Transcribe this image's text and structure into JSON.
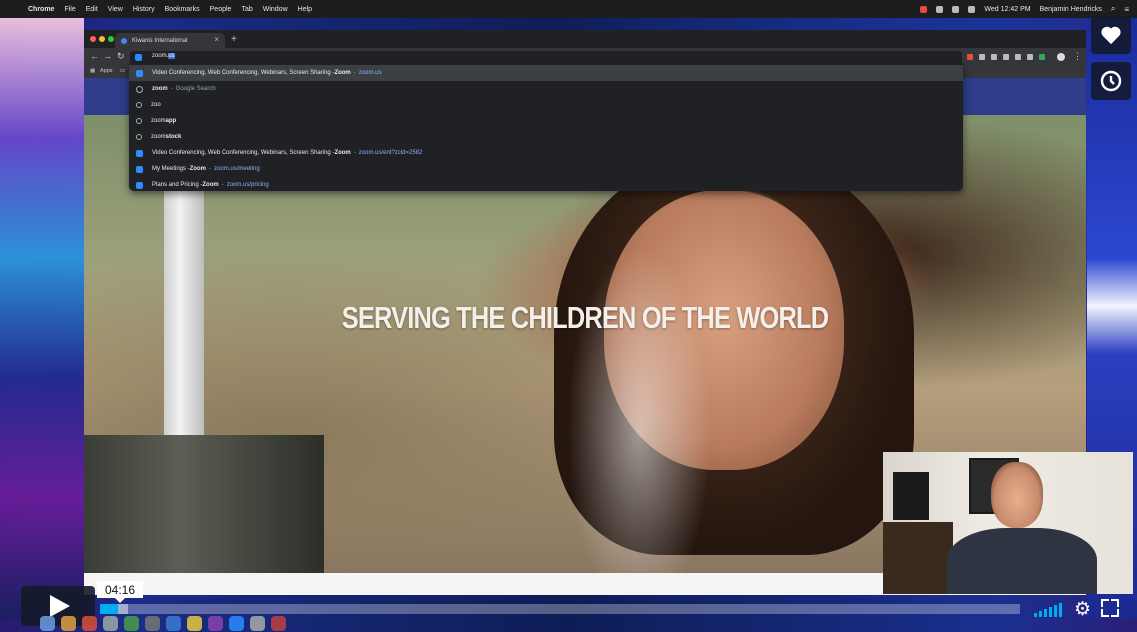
{
  "menubar": {
    "app": "Chrome",
    "items": [
      "File",
      "Edit",
      "View",
      "History",
      "Bookmarks",
      "People",
      "Tab",
      "Window",
      "Help"
    ],
    "clock": "Wed 12:42 PM",
    "user": "Benjamin Hendricks"
  },
  "browser": {
    "tab_title": "Kiwanis International",
    "tab_close": "×",
    "new_tab": "+",
    "omnibox_typed": "zoom.",
    "omnibox_autocomplete": "us",
    "bookmarks": {
      "apps_label": "Apps"
    }
  },
  "suggestions": [
    {
      "icon": "zoom-favicon",
      "text": "Video Conferencing, Web Conferencing, Webinars, Screen Sharing - ",
      "bold": "Zoom",
      "sep": " - ",
      "url": "zoom.us",
      "highlight": true
    },
    {
      "icon": "history-icon",
      "text": "",
      "bold": "zoom",
      "sep": " - ",
      "dim": "Google Search"
    },
    {
      "icon": "search-icon",
      "text": "zoo"
    },
    {
      "icon": "search-icon",
      "text": "zoom ",
      "bold": "app"
    },
    {
      "icon": "search-icon",
      "text": "zoom ",
      "bold": "stock"
    },
    {
      "icon": "zoom-favicon",
      "text": "Video Conferencing, Web Conferencing, Webinars, Screen Sharing - ",
      "bold": "Zoom",
      "sep": " - ",
      "url": "zoom.us/ent?zcid=2582"
    },
    {
      "icon": "zoom-favicon",
      "text": "My Meetings - ",
      "bold": "Zoom",
      "sep": " - ",
      "url": "zoom.us/meeting"
    },
    {
      "icon": "zoom-favicon",
      "text": "Plans and Pricing - ",
      "bold": "Zoom",
      "sep": " - ",
      "url": "zoom.us/pricing"
    }
  ],
  "page": {
    "headline": "SERVING THE CHILDREN OF THE WORLD"
  },
  "player": {
    "current_time": "04:16",
    "progress_fraction": 0.02,
    "buffered_fraction": 0.03,
    "accent": "#00adef"
  },
  "icons": {
    "like": "heart-icon",
    "watch_later": "clock-icon",
    "play": "play-icon",
    "volume": "volume-icon",
    "settings": "gear-icon",
    "fullscreen": "fullscreen-icon"
  }
}
